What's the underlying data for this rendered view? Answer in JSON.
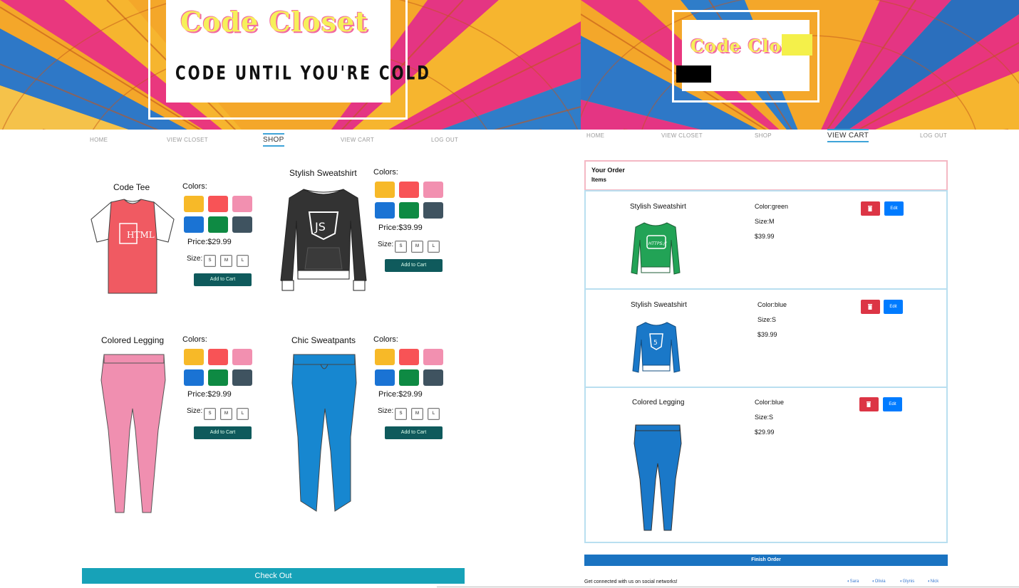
{
  "colors": {
    "swatches": [
      "#f7b928",
      "#f85356",
      "#f290b0",
      "#1a73d4",
      "#0e8a43",
      "#3f5360"
    ],
    "checkout": "#17a2b8",
    "add_to_cart": "#0f5a5c",
    "delete": "#dc3545",
    "edit": "#007bff",
    "finish": "#1a73c1"
  },
  "shop": {
    "logo": {
      "title": "Code Closet",
      "tagline": "CODE UNTIL YOU'RE COLD"
    },
    "nav": [
      "HOME",
      "VIEW CLOSET",
      "SHOP",
      "VIEW CART",
      "LOG OUT"
    ],
    "active_nav": "SHOP",
    "products": [
      {
        "name": "Code Tee",
        "colors_label": "Colors:",
        "price": "Price:$29.99",
        "size_label": "Size:",
        "sizes": [
          "S",
          "M",
          "L"
        ],
        "add_label": "Add to Cart",
        "image": "tshirt-html"
      },
      {
        "name": "Stylish Sweatshirt",
        "colors_label": "Colors:",
        "price": "Price:$39.99",
        "size_label": "Size:",
        "sizes": [
          "S",
          "M",
          "L"
        ],
        "add_label": "Add to Cart",
        "image": "sweatshirt-js"
      },
      {
        "name": "Colored Legging",
        "colors_label": "Colors:",
        "price": "Price:$29.99",
        "size_label": "Size:",
        "sizes": [
          "S",
          "M",
          "L"
        ],
        "add_label": "Add to Cart",
        "image": "legging-pink"
      },
      {
        "name": "Chic Sweatpants",
        "colors_label": "Colors:",
        "price": "Price:$29.99",
        "size_label": "Size:",
        "sizes": [
          "S",
          "M",
          "L"
        ],
        "add_label": "Add to Cart",
        "image": "sweatpants-blue"
      }
    ],
    "checkout_label": "Check Out"
  },
  "cart": {
    "logo": {
      "title": "Code Clos"
    },
    "nav": [
      "HOME",
      "VIEW CLOSET",
      "SHOP",
      "VIEW CART",
      "LOG OUT"
    ],
    "active_nav": "VIEW CART",
    "order_title": "Your Order",
    "items_label": "Items",
    "items": [
      {
        "name": "Stylish Sweatshirt",
        "color": "Color:green",
        "size": "Size:M",
        "price": "$39.99",
        "edit_label": "Edit",
        "image": "sweatshirt-green"
      },
      {
        "name": "Stylish Sweatshirt",
        "color": "Color:blue",
        "size": "Size:S",
        "price": "$39.99",
        "edit_label": "Edit",
        "image": "sweatshirt-blue"
      },
      {
        "name": "Colored Legging",
        "color": "Color:blue",
        "size": "Size:S",
        "price": "$29.99",
        "edit_label": "Edit",
        "image": "legging-blue"
      }
    ],
    "finish_label": "Finish Order",
    "social_text": "Get connected with us on social networks!",
    "social_links": [
      "Sara",
      "Olivia",
      "Glynis",
      "Nick"
    ]
  }
}
